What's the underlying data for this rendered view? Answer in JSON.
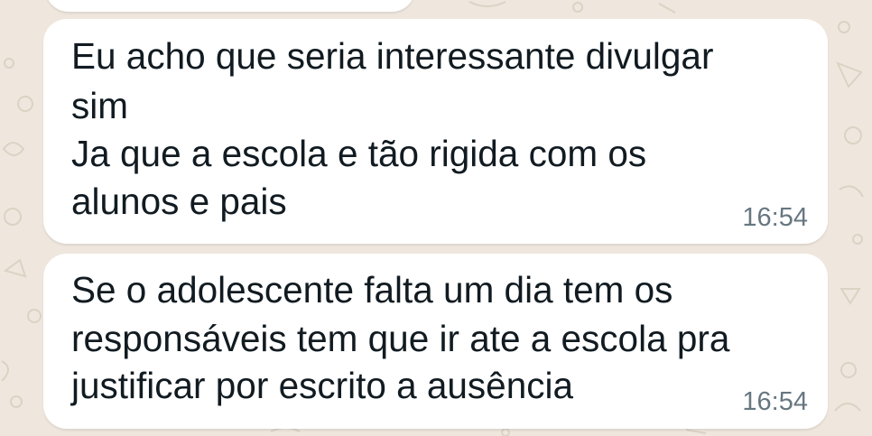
{
  "messages": [
    {
      "lines": [
        "Eu acho que seria interessante divulgar",
        "sim",
        "Ja que a escola e tão rigida com os",
        "alunos e pais"
      ],
      "time": "16:54"
    },
    {
      "lines": [
        "Se o adolescente falta um dia tem os",
        "responsáveis tem que ir ate a escola pra",
        "justificar por escrito a ausência"
      ],
      "time": "16:54"
    }
  ],
  "colors": {
    "background": "#efe7dd",
    "bubble": "#ffffff",
    "text": "#111b21",
    "timestamp": "#667781"
  }
}
